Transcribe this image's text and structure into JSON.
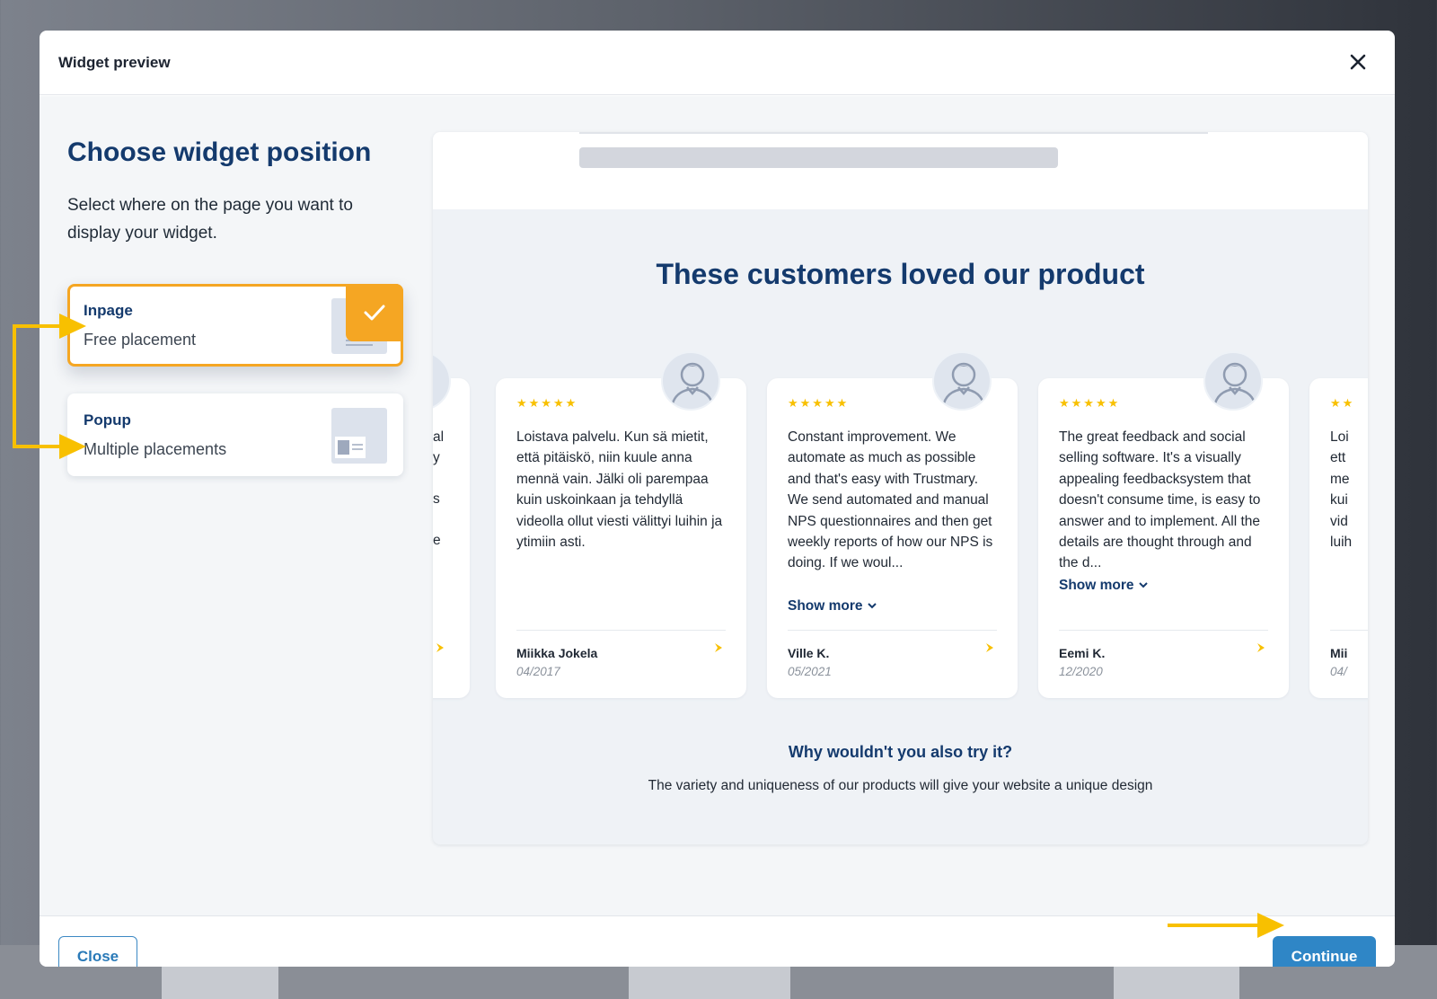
{
  "modal": {
    "title": "Widget preview"
  },
  "left": {
    "heading": "Choose widget position",
    "subtitle": "Select where on the page you want to display your widget.",
    "options": [
      {
        "title": "Inpage",
        "description": "Free placement",
        "selected": true
      },
      {
        "title": "Popup",
        "description": "Multiple placements",
        "selected": false
      }
    ]
  },
  "preview": {
    "title": "These customers loved our product",
    "question": "Why wouldn't you also try it?",
    "description": "The variety and uniqueness of our products will give your website a unique design",
    "partial_left": {
      "line1": "al",
      "line2": "y",
      "line3": "s",
      "line4": "e"
    },
    "partial_right": {
      "stars": "★★",
      "lines": [
        "Loi",
        "ett",
        "me",
        "kui",
        "vid",
        "luih"
      ],
      "author": "Mii",
      "date": "04/"
    },
    "reviews": [
      {
        "stars": "★★★★★",
        "text": "Loistava palvelu. Kun sä mietit, että pitäiskö, niin kuule anna mennä vain. Jälki oli parempaa kuin uskoinkaan ja tehdyllä videolla ollut viesti välittyi luihin ja ytimiin asti.",
        "show_more": "",
        "author": "Miikka Jokela",
        "date": "04/2017"
      },
      {
        "stars": "★★★★★",
        "text": "Constant improvement. We automate as much as possible and that's easy with Trustmary. We send automated and manual NPS questionnaires and then get weekly reports of how our NPS is doing. If we woul...",
        "show_more": "Show more",
        "author": "Ville K.",
        "date": "05/2021"
      },
      {
        "stars": "★★★★★",
        "text": "The great feedback and social selling software. It's a visually appealing feedbacksystem that doesn't consume time, is easy to answer and to implement. All the details are thought through and the d...",
        "show_more": "Show more",
        "author": "Eemi K.",
        "date": "12/2020"
      }
    ]
  },
  "footer": {
    "close_label": "Close",
    "continue_label": "Continue"
  },
  "colors": {
    "brand_navy": "#143a6d",
    "accent_orange": "#f5a623",
    "arrow_yellow": "#f8c000",
    "primary_blue": "#2f86c6"
  }
}
